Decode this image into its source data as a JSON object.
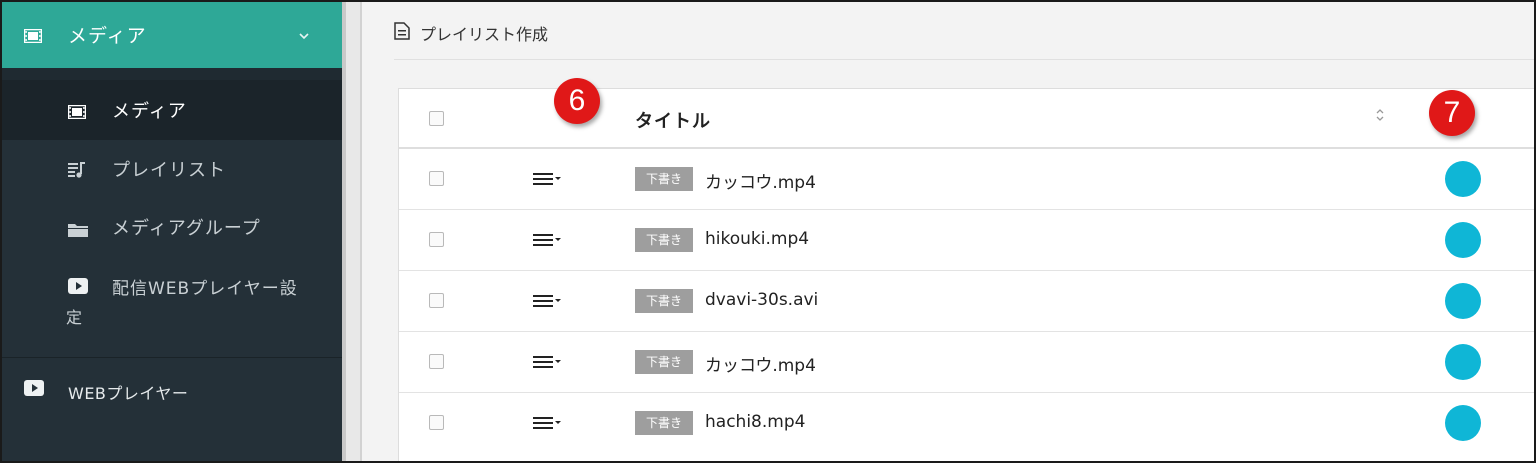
{
  "sidebar": {
    "header": {
      "label": "メディア",
      "icon": "film-icon"
    },
    "items": [
      {
        "label": "メディア",
        "icon": "film-icon",
        "active": true
      },
      {
        "label": "プレイリスト",
        "icon": "playlist-icon",
        "active": false
      },
      {
        "label": "メディアグループ",
        "icon": "folder-icon",
        "active": false
      },
      {
        "label_line1": "配信WEBプレイヤー設",
        "label_line2": "定",
        "icon": "youtube-play-icon",
        "active": false
      }
    ],
    "web_player": {
      "label": "WEBプレイヤー",
      "icon": "youtube-play-icon"
    }
  },
  "breadcrumb": {
    "label": "プレイリスト作成",
    "icon": "document-icon"
  },
  "table": {
    "header": {
      "title": "タイトル"
    },
    "rows": [
      {
        "badge": "下書き",
        "filename": "カッコウ.mp4"
      },
      {
        "badge": "下書き",
        "filename": "hikouki.mp4"
      },
      {
        "badge": "下書き",
        "filename": "dvavi-30s.avi"
      },
      {
        "badge": "下書き",
        "filename": "カッコウ.mp4"
      },
      {
        "badge": "下書き",
        "filename": "hachi8.mp4"
      }
    ]
  },
  "callouts": {
    "six": "6",
    "seven": "7"
  },
  "colors": {
    "accent": "#2ea897",
    "sidebar": "#243038",
    "status_dot": "#0fb6d6",
    "callout": "#e01818",
    "badge": "#9e9e9e"
  }
}
